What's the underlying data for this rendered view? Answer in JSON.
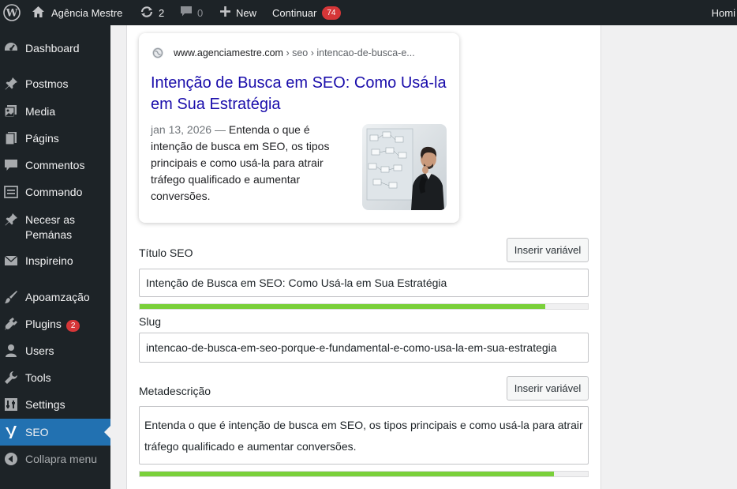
{
  "adminbar": {
    "site_name": "Agência Mestre",
    "updates_count": "2",
    "comments_count": "0",
    "new_label": "New",
    "continuar_label": "Continuar",
    "continuar_badge": "74",
    "howdy": "Homi"
  },
  "sidebar": {
    "items": [
      {
        "label": "Dashboard",
        "icon": "dashboard-icon"
      },
      {
        "label": "Postmos",
        "icon": "pin-icon"
      },
      {
        "label": "Media",
        "icon": "media-icon"
      },
      {
        "label": "Págins",
        "icon": "page-icon"
      },
      {
        "label": "Commentos",
        "icon": "comment-icon"
      },
      {
        "label": "Commǝndo",
        "icon": "form-icon"
      },
      {
        "label": "Necesr as Pemánas",
        "icon": "pin-icon"
      },
      {
        "label": "Inspireino",
        "icon": "mail-icon"
      },
      {
        "label": "Apoamzação",
        "icon": "brush-icon"
      },
      {
        "label": "Plugins",
        "icon": "plugin-icon",
        "badge": "2"
      },
      {
        "label": "Users",
        "icon": "user-icon"
      },
      {
        "label": "Tools",
        "icon": "wrench-icon"
      },
      {
        "label": "Settings",
        "icon": "settings-icon"
      },
      {
        "label": "SEO",
        "icon": "yoast-icon",
        "current": true
      },
      {
        "label": "Collapra menu",
        "icon": "collapse-icon"
      }
    ]
  },
  "preview": {
    "url": "www.agenciamestre.com",
    "breadcrumb": "› seo › intencao-de-busca-e...",
    "title": "Intenção de Busca em SEO: Como Usá-la em Sua Estratégia",
    "date": "jan 13, 2026 —",
    "description": "Entenda o que é intenção de busca em SEO, os tipos principais e como usá-la para atrair tráfego qualificado e aumentar conversões."
  },
  "seo_title": {
    "label": "Título SEO",
    "button": "Inserir variável",
    "value": "Intenção de Busca em SEO: Como Usá-la em Sua Estratégia",
    "progress": 0.905
  },
  "slug": {
    "label": "Slug",
    "value": "intencao-de-busca-em-seo-porque-e-fundamental-e-como-usa-la-em-sua-estrategia"
  },
  "meta": {
    "label": "Metadescrição",
    "button": "Inserir variável",
    "value": "Entenda o que é intenção de busca em SEO, os tipos principais e como usá-la para atrair tráfego qualificado e aumentar conversões.",
    "progress": 0.925
  },
  "colors": {
    "accent": "#2271b1",
    "progress_good": "#7ad03a",
    "link": "#1a0dab",
    "badge": "#d63638"
  }
}
